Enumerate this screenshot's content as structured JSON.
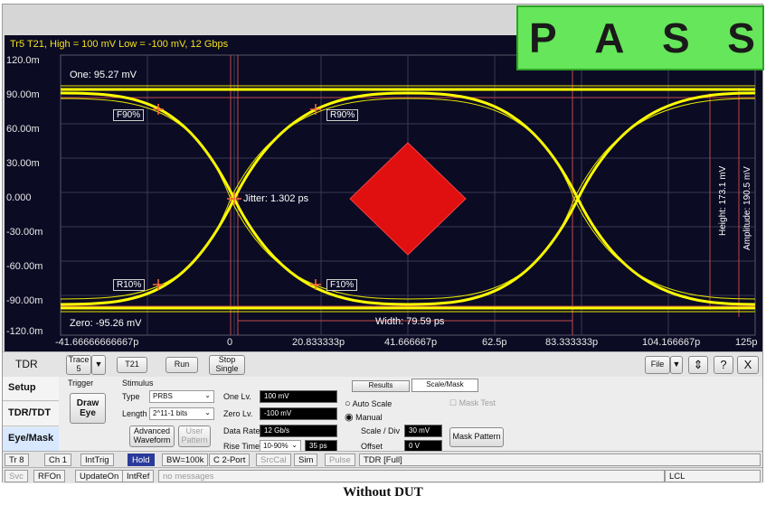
{
  "pass_banner": [
    "P",
    "A",
    "S",
    "S"
  ],
  "plot": {
    "title": "Tr5 T21, High = 100 mV Low = -100 mV, 12 Gbps",
    "y_ticks": [
      "120.0m",
      "90.00m",
      "60.00m",
      "30.00m",
      "0.000",
      "-30.00m",
      "-60.00m",
      "-90.00m",
      "-120.0m"
    ],
    "x_ticks": [
      "-41.66666666667p",
      "0",
      "20.833333p",
      "41.666667p",
      "62.5p",
      "83.333333p",
      "104.166667p",
      "125p"
    ],
    "one_level": "One: 95.27 mV",
    "zero_level": "Zero: -95.26 mV",
    "jitter": "Jitter: 1.302 ps",
    "width": "Width: 79.59 ps",
    "height": "Height: 173.1 mV",
    "amplitude": "Amplitude: 190.5 mV",
    "markers": {
      "f90": "F90%",
      "r90": "R90%",
      "r10": "R10%",
      "f10": "F10%"
    },
    "colors": {
      "background": "#0b0b24",
      "trace": "#ffff00",
      "mask": "#e01010",
      "cursor": "#d05050"
    }
  },
  "toolbar": {
    "mode": "TDR",
    "trace_label": "Trace",
    "trace_value": "5",
    "t21": "T21",
    "run": "Run",
    "stop_single": "Stop Single",
    "file": "File",
    "help": "?",
    "close": "X"
  },
  "side_tabs": [
    "Setup",
    "TDR/TDT",
    "Eye/Mask"
  ],
  "trigger": {
    "title": "Trigger",
    "draw_eye": "Draw Eye"
  },
  "stimulus": {
    "title": "Stimulus",
    "type_label": "Type",
    "type_value": "PRBS",
    "length_label": "Length",
    "length_value": "2^11-1 bits",
    "advanced_waveform": "Advanced Waveform",
    "user_pattern": "User Pattern",
    "one_lv_label": "One Lv.",
    "one_lv_value": "100 mV",
    "zero_lv_label": "Zero Lv.",
    "zero_lv_value": "-100 mV",
    "data_rate_label": "Data Rate",
    "data_rate_value": "12 Gb/s",
    "rise_time_label": "Rise Time",
    "rise_time_mode": "10-90%",
    "rise_time_value": "35 ps"
  },
  "results": {
    "tab_results": "Results",
    "tab_scale_mask": "Scale/Mask",
    "auto_scale": "Auto Scale",
    "manual": "Manual",
    "mask_test": "Mask Test",
    "scale_div_label": "Scale / Div",
    "scale_div_value": "30 mV",
    "offset_label": "Offset",
    "offset_value": "0 V",
    "mask_pattern": "Mask Pattern"
  },
  "status_row1": [
    "Tr 8",
    "Ch 1",
    "IntTrig",
    "Hold",
    "BW=100k",
    "C 2-Port",
    "SrcCal",
    "Sim",
    "Pulse",
    "TDR [Full]"
  ],
  "status_row2": [
    "Svc",
    "RFOn",
    "UpdateOn",
    "IntRef",
    "no messages",
    "LCL"
  ],
  "caption": "Without DUT"
}
